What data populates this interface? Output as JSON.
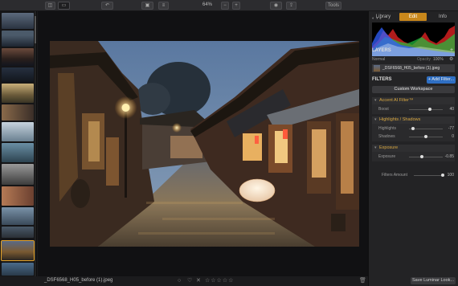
{
  "toolbar": {
    "zoom_value": "64%",
    "zoom_minus": "−",
    "zoom_plus": "+",
    "tools_label": "Tools"
  },
  "panel_tabs": [
    "Library",
    "Edit",
    "Info"
  ],
  "layers": {
    "title": "LAYERS",
    "blend_mode": "Normal",
    "opacity_label": "Opacity",
    "opacity_value": "100%",
    "layer_name": "_DSF6568_H05_before (1).jpeg"
  },
  "filters": {
    "title": "FILTERS",
    "add_filter": "+ Add Filter...",
    "workspace": "Custom Workspace",
    "groups": [
      {
        "name": "Accent AI Filter™",
        "rows": [
          {
            "label": "Boost",
            "value": "40",
            "pos": 0.62
          }
        ]
      },
      {
        "name": "Highlights / Shadows",
        "rows": [
          {
            "label": "Highlights",
            "value": "-77",
            "pos": 0.12
          },
          {
            "label": "Shadows",
            "value": "0",
            "pos": 0.5
          }
        ]
      },
      {
        "name": "Exposure",
        "rows": [
          {
            "label": "Exposure",
            "value": "-0.85",
            "pos": 0.38
          }
        ]
      }
    ],
    "amount_label": "Filters Amount",
    "amount_value": "100",
    "amount_pos": 1.0
  },
  "footer": {
    "filename": "_DSF6568_H05_before (1).jpeg",
    "save_look": "Save Luminar Look..."
  },
  "colors": {
    "accent": "#c8871b",
    "active_tab": "#c8871b",
    "add_filter": "#2f6fc3"
  }
}
